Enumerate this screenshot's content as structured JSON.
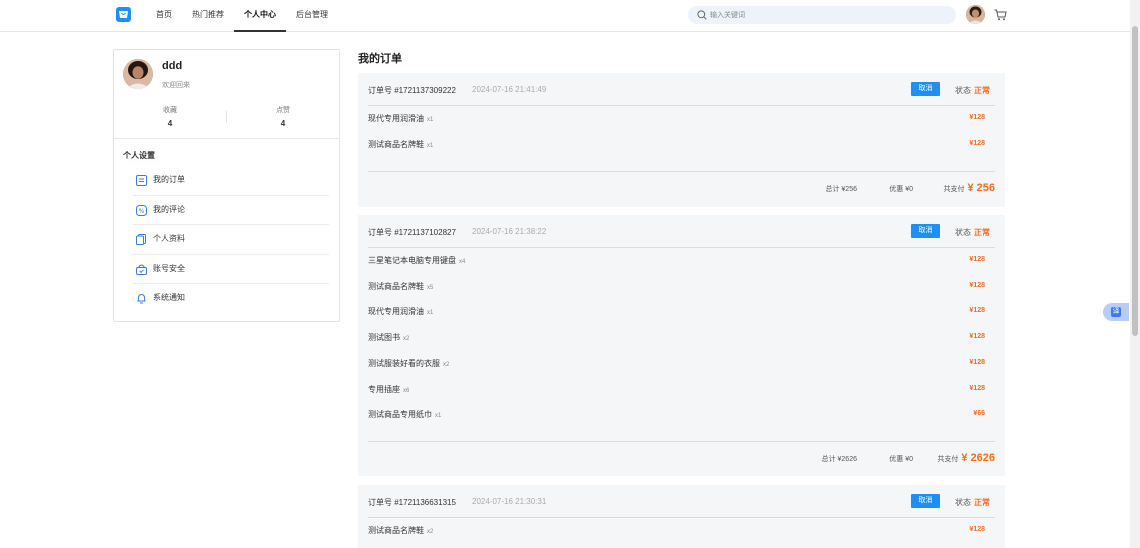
{
  "header": {
    "nav": [
      {
        "label": "首页"
      },
      {
        "label": "热门推荐"
      },
      {
        "label": "个人中心"
      },
      {
        "label": "后台管理"
      }
    ],
    "search_placeholder": "输入关键词"
  },
  "sidebar": {
    "username": "ddd",
    "welcome": "欢迎回来",
    "stats": [
      {
        "label": "收藏",
        "value": "4"
      },
      {
        "label": "点赞",
        "value": "4"
      }
    ],
    "settings_title": "个人设置",
    "menu": [
      {
        "label": "我的订单",
        "icon": "order-icon"
      },
      {
        "label": "我的评论",
        "icon": "comment-icon"
      },
      {
        "label": "个人资料",
        "icon": "profile-icon"
      },
      {
        "label": "账号安全",
        "icon": "lock-icon"
      },
      {
        "label": "系统通知",
        "icon": "bell-icon"
      }
    ]
  },
  "main": {
    "title": "我的订单",
    "orders": [
      {
        "no": "订单号 #1721137309222",
        "time": "2024-07-16 21:41:49",
        "cancel": "取消",
        "status_label": "状态",
        "status": "正常",
        "items": [
          {
            "name": "现代专用润滑油",
            "qty": "x1",
            "price": "¥128"
          },
          {
            "name": "测试商品名牌鞋",
            "qty": "x1",
            "price": "¥128"
          }
        ],
        "total": "总计 ¥256",
        "discount": "优惠 ¥0",
        "pay_label": "共支付",
        "pay": "¥ 256"
      },
      {
        "no": "订单号 #1721137102827",
        "time": "2024-07-16 21:38:22",
        "cancel": "取消",
        "status_label": "状态",
        "status": "正常",
        "items": [
          {
            "name": "三星笔记本电脑专用键盘",
            "qty": "x4",
            "price": "¥128"
          },
          {
            "name": "测试商品名牌鞋",
            "qty": "x5",
            "price": "¥128"
          },
          {
            "name": "现代专用润滑油",
            "qty": "x1",
            "price": "¥128"
          },
          {
            "name": "测试图书",
            "qty": "x2",
            "price": "¥128"
          },
          {
            "name": "测试服装好看的衣服",
            "qty": "x2",
            "price": "¥128"
          },
          {
            "name": "专用插座",
            "qty": "x6",
            "price": "¥128"
          },
          {
            "name": "测试商品专用纸巾",
            "qty": "x1",
            "price": "¥66"
          }
        ],
        "total": "总计 ¥2626",
        "discount": "优惠 ¥0",
        "pay_label": "共支付",
        "pay": "¥ 2626"
      },
      {
        "no": "订单号 #1721136631315",
        "time": "2024-07-16 21:30:31",
        "cancel": "取消",
        "status_label": "状态",
        "status": "正常",
        "items": [
          {
            "name": "测试商品名牌鞋",
            "qty": "x2",
            "price": "¥128"
          }
        ]
      }
    ]
  },
  "float_button": {
    "label": "译"
  },
  "colors": {
    "accent": "#1e8ff5",
    "price": "#f56c1b",
    "card_bg": "#f5f6f8"
  }
}
